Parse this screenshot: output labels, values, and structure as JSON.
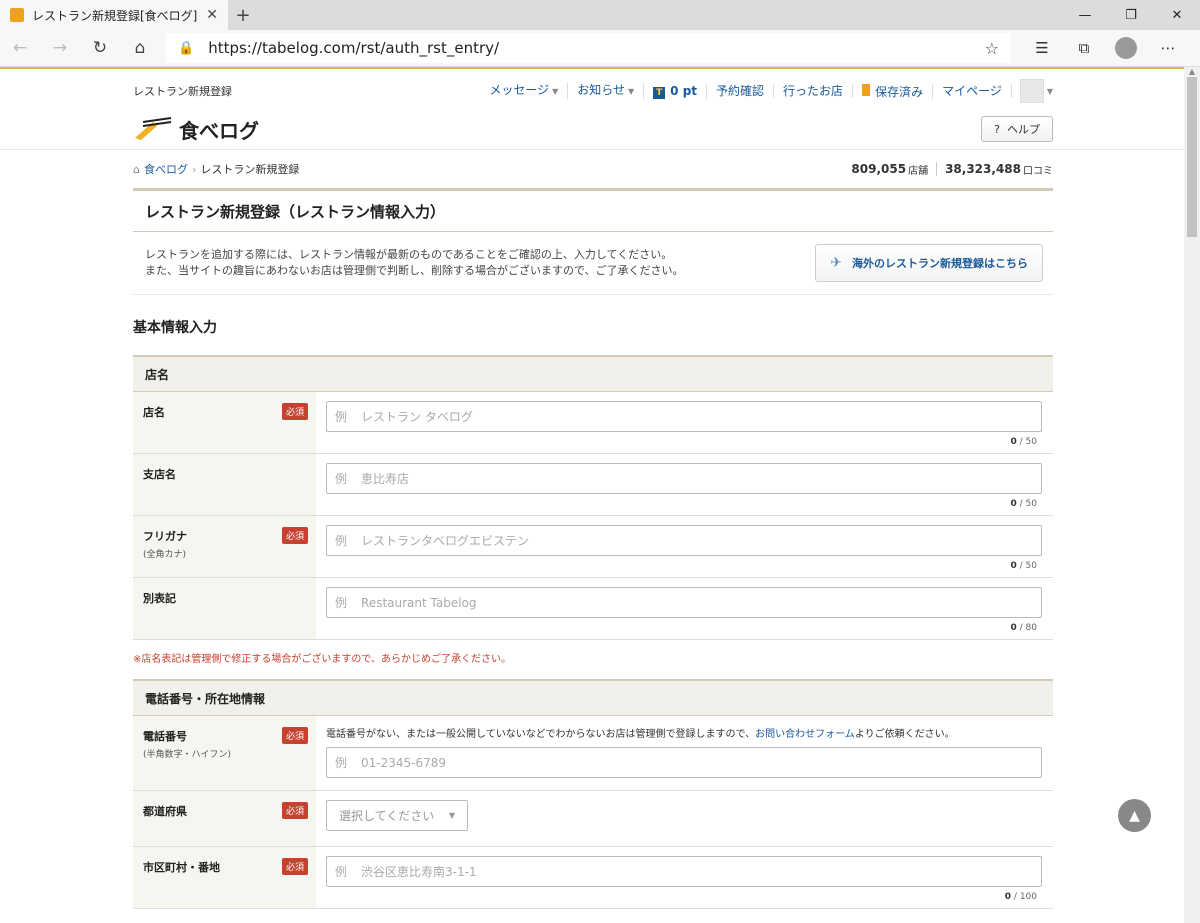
{
  "browser": {
    "tab_title": "レストラン新規登録[食べログ]",
    "new_tab": "+",
    "url": "https://tabelog.com/rst/auth_rst_entry/"
  },
  "header": {
    "page_label": "レストラン新規登録",
    "nav": {
      "message": "メッセージ",
      "notice": "お知らせ",
      "points": "0 pt",
      "reservation": "予約確認",
      "visited": "行ったお店",
      "saved": "保存済み",
      "mypage": "マイページ"
    },
    "logo_text": "食べログ",
    "help": "ヘルプ"
  },
  "breadcrumb": {
    "home": "食べログ",
    "current": "レストラン新規登録"
  },
  "counts": {
    "stores": "809,055",
    "stores_unit": "店舗",
    "reviews": "38,323,488",
    "reviews_unit": "口コミ"
  },
  "main": {
    "title": "レストラン新規登録（レストラン情報入力）",
    "intro_line1": "レストランを追加する際には、レストラン情報が最新のものであることをご確認の上、入力してください。",
    "intro_line2": "また、当サイトの趣旨にあわないお店は管理側で判断し、削除する場合がございますので、ご了承ください。",
    "overseas_button": "海外のレストラン新規登録はこちら",
    "section_title": "基本情報入力"
  },
  "required_label": "必須",
  "example_label": "例",
  "group_name": {
    "heading": "店名",
    "fields": [
      {
        "label": "店名",
        "sub": "",
        "placeholder": "レストラン タベログ",
        "count": "0",
        "max": "/ 50"
      },
      {
        "label": "支店名",
        "sub": "",
        "placeholder": "恵比寿店",
        "count": "0",
        "max": "/ 50"
      },
      {
        "label": "フリガナ",
        "sub": "(全角カナ)",
        "placeholder": "レストランタベログエビステン",
        "count": "0",
        "max": "/ 50"
      },
      {
        "label": "別表記",
        "sub": "",
        "placeholder": "Restaurant Tabelog",
        "count": "0",
        "max": "/ 80"
      }
    ],
    "note": "※店名表記は管理側で修正する場合がございますので、あらかじめご了承ください。"
  },
  "group_phone": {
    "heading": "電話番号・所在地情報",
    "phone_label": "電話番号",
    "phone_sub": "(半角数字・ハイフン)",
    "phone_note_before": "電話番号がない、または一般公開していないなどでわからないお店は管理側で登録しますので、",
    "phone_note_link": "お問い合わせフォーム",
    "phone_note_after": "よりご依頼ください。",
    "phone_placeholder": "01-2345-6789",
    "pref_label": "都道府県",
    "pref_select": "選択してください",
    "city_label": "市区町村・番地",
    "city_placeholder": "渋谷区恵比寿南3-1-1",
    "city_count": "0",
    "city_max": "/ 100"
  }
}
